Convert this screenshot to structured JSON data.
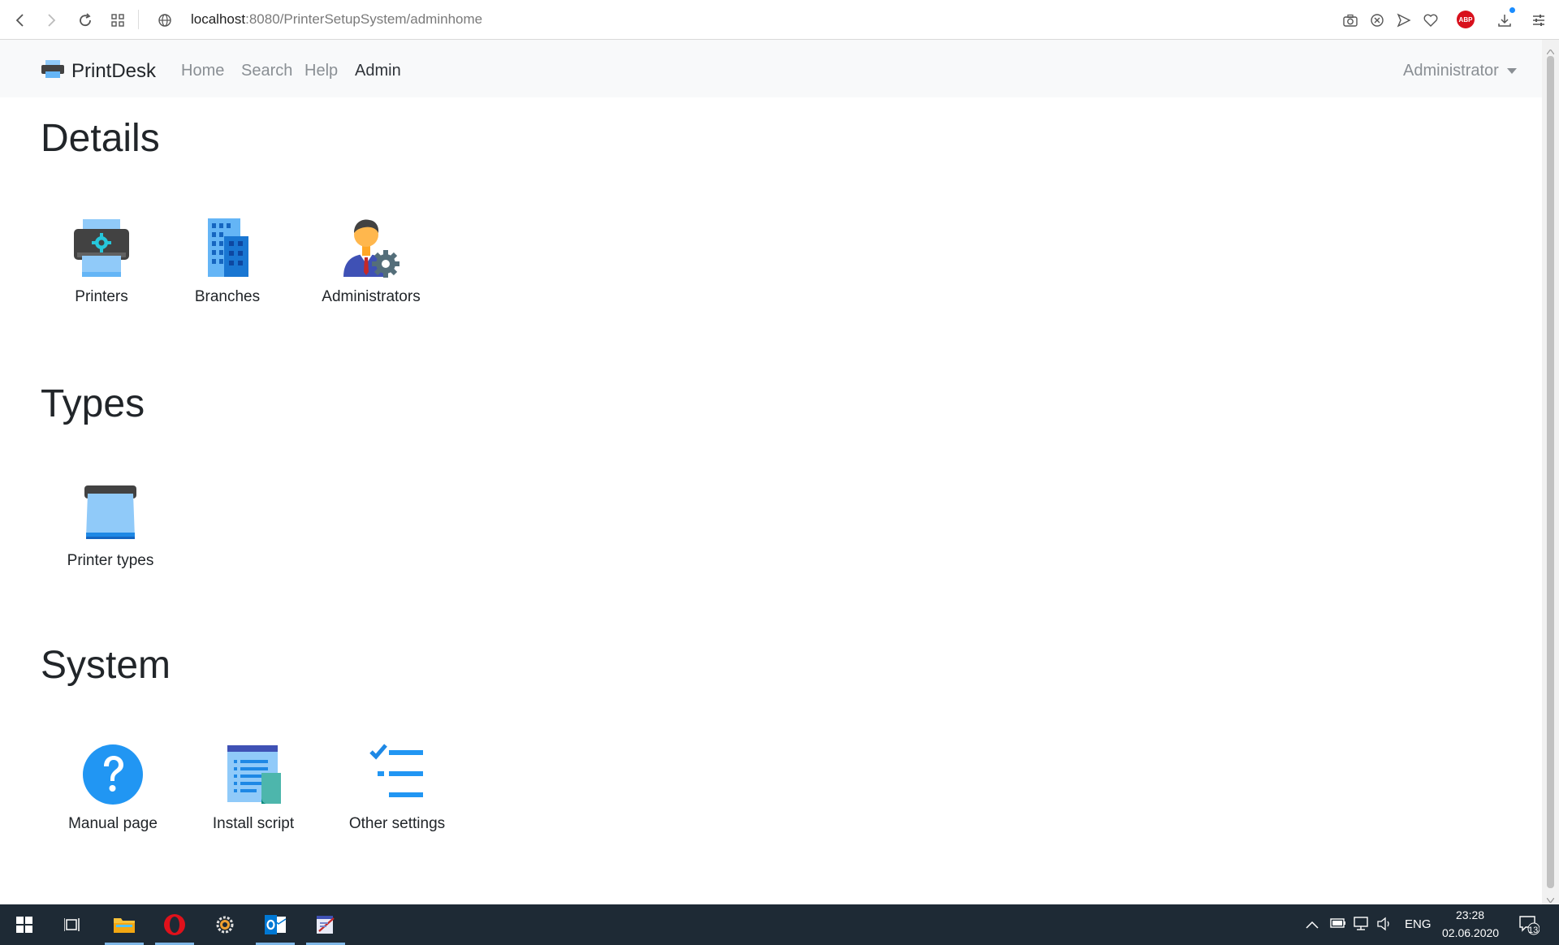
{
  "browser": {
    "url_host": "localhost",
    "url_rest": ":8080/PrinterSetupSystem/adminhome",
    "abp_label": "ABP"
  },
  "navbar": {
    "brand": "PrintDesk",
    "links": [
      "Home",
      "Search",
      "Help",
      "Admin"
    ],
    "active_link": "Admin",
    "user": "Administrator"
  },
  "sections": {
    "details": {
      "title": "Details",
      "items": [
        {
          "label": "Printers",
          "icon": "printer-settings-icon"
        },
        {
          "label": "Branches",
          "icon": "office-building-icon"
        },
        {
          "label": "Administrators",
          "icon": "administrator-settings-icon"
        }
      ]
    },
    "types": {
      "title": "Types",
      "items": [
        {
          "label": "Printer types",
          "icon": "printer-paper-icon"
        }
      ]
    },
    "system": {
      "title": "System",
      "items": [
        {
          "label": "Manual page",
          "icon": "help-question-icon"
        },
        {
          "label": "Install script",
          "icon": "script-document-icon"
        },
        {
          "label": "Other settings",
          "icon": "checklist-icon"
        }
      ]
    }
  },
  "taskbar": {
    "language": "ENG",
    "time": "23:28",
    "date": "02.06.2020",
    "notifications": "13"
  },
  "colors": {
    "navbar_bg": "#f8f9fa",
    "taskbar_bg": "#1e2a35",
    "icon_blue": "#2196f3"
  }
}
